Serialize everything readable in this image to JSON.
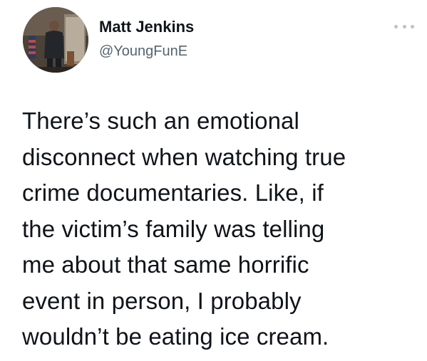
{
  "author": {
    "name": "Matt Jenkins",
    "handle": "@YoungFunE"
  },
  "icons": {
    "more": "more-options-icon",
    "avatar": "profile-photo"
  },
  "tweet": {
    "lines": [
      "There’s such an emotional",
      "disconnect when watching true",
      "crime documentaries. Like, if",
      "the victim’s family was telling",
      "me about that same horrific",
      "event in person, I probably",
      "wouldn’t be eating ice cream."
    ]
  },
  "colors": {
    "text": "#0f1419",
    "secondary": "#536471"
  }
}
